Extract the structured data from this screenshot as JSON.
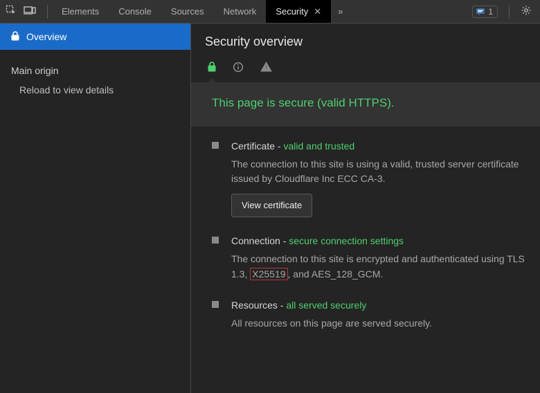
{
  "tabs": {
    "items": [
      {
        "label": "Elements"
      },
      {
        "label": "Console"
      },
      {
        "label": "Sources"
      },
      {
        "label": "Network"
      },
      {
        "label": "Security",
        "active": true
      },
      {
        "label": "»"
      }
    ],
    "message_count": "1"
  },
  "sidebar": {
    "overview_label": "Overview",
    "origin_heading": "Main origin",
    "origin_sub": "Reload to view details"
  },
  "page": {
    "title": "Security overview",
    "summary": "This page is secure (valid HTTPS)."
  },
  "sections": [
    {
      "title": "Certificate",
      "status": "valid and trusted",
      "desc_pre": "The connection to this site is using a valid, trusted server certificate issued by ",
      "desc_issuer": "Cloudflare Inc ECC CA-3",
      "desc_post": ".",
      "button": "View certificate"
    },
    {
      "title": "Connection",
      "status": "secure connection settings",
      "desc_pre": "The connection to this site is encrypted and authenticated using TLS 1.3, ",
      "highlight": "X25519",
      "desc_mid": ", and ",
      "cipher": "AES_128_GCM",
      "desc_post": "."
    },
    {
      "title": "Resources",
      "status": "all served securely",
      "desc": "All resources on this page are served securely."
    }
  ]
}
